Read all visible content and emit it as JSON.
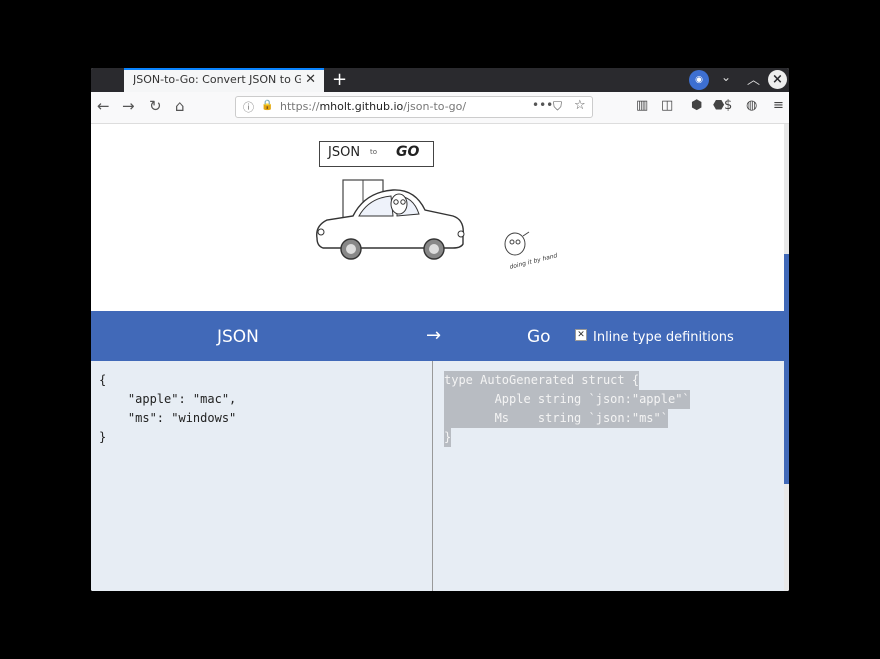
{
  "browser": {
    "tab_title": "JSON-to-Go: Convert JSON to Go i",
    "tab_close": "✕",
    "new_tab": "+",
    "url_scheme": "https://",
    "url_host": "mholt.github.io",
    "url_path": "/json-to-go/",
    "url_more": "•••"
  },
  "page": {
    "logo_json": "JSON",
    "logo_to": "to",
    "logo_go": "GO",
    "gopher_caption": "doing it by hand",
    "header": {
      "json_label": "JSON",
      "arrow": "→",
      "go_label": "Go",
      "inline_types_label": "Inline type definitions",
      "inline_types_checked": true
    },
    "input_lines": [
      "{",
      "    \"apple\": \"mac\",",
      "    \"ms\": \"windows\"",
      "}"
    ],
    "output_lines": [
      "type AutoGenerated struct {",
      "       Apple string `json:\"apple\"`",
      "       Ms    string `json:\"ms\"`",
      "}"
    ]
  },
  "colors": {
    "band": "#4169b8",
    "pane_bg": "#e7edf4",
    "selection": "#b8bcc2"
  }
}
